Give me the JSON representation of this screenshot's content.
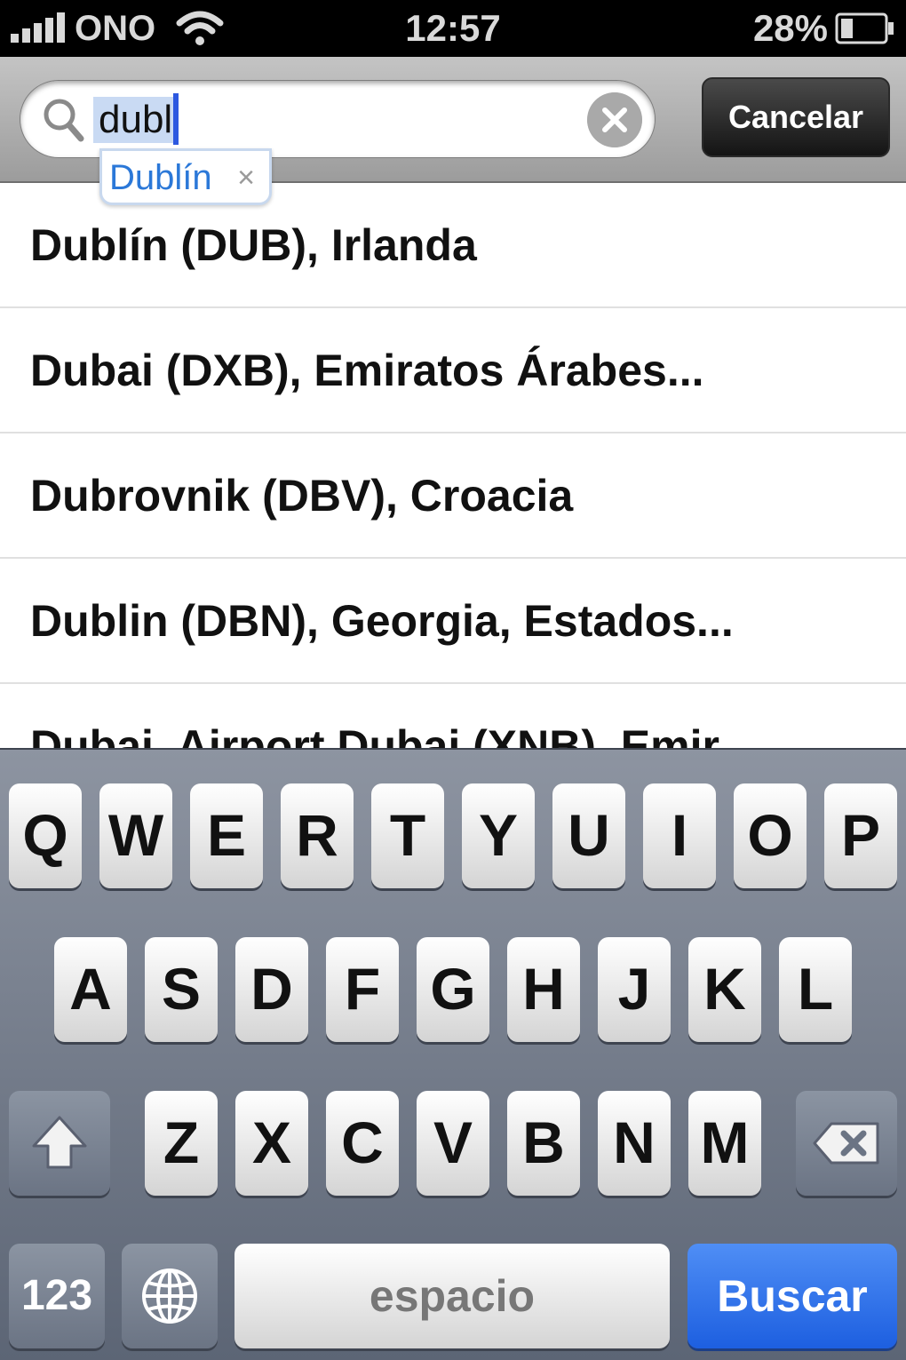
{
  "status_bar": {
    "carrier": "ONO",
    "time": "12:57",
    "battery_percent": "28%",
    "battery_level": 0.28,
    "icons": [
      "signal-bars-icon",
      "wifi-icon",
      "battery-icon"
    ]
  },
  "search": {
    "query": "dubl",
    "cancel_label": "Cancelar",
    "autocorrect_suggestion": "Dublín",
    "autocorrect_dismiss": "×"
  },
  "results": [
    "Dublín (DUB), Irlanda",
    "Dubai (DXB), Emiratos Árabes...",
    "Dubrovnik (DBV), Croacia",
    "Dublin (DBN), Georgia, Estados...",
    "Dubai, Airport Dubai (XNB), Emir..."
  ],
  "keyboard": {
    "row1": [
      "Q",
      "W",
      "E",
      "R",
      "T",
      "Y",
      "U",
      "I",
      "O",
      "P"
    ],
    "row2": [
      "A",
      "S",
      "D",
      "F",
      "G",
      "H",
      "J",
      "K",
      "L"
    ],
    "row3": [
      "Z",
      "X",
      "C",
      "V",
      "B",
      "N",
      "M"
    ],
    "numbers_label": "123",
    "space_label": "espacio",
    "return_label": "Buscar"
  },
  "colors": {
    "accent_blue": "#1d5fe0",
    "selection": "#c9daf3",
    "cursor": "#2c58e0"
  }
}
